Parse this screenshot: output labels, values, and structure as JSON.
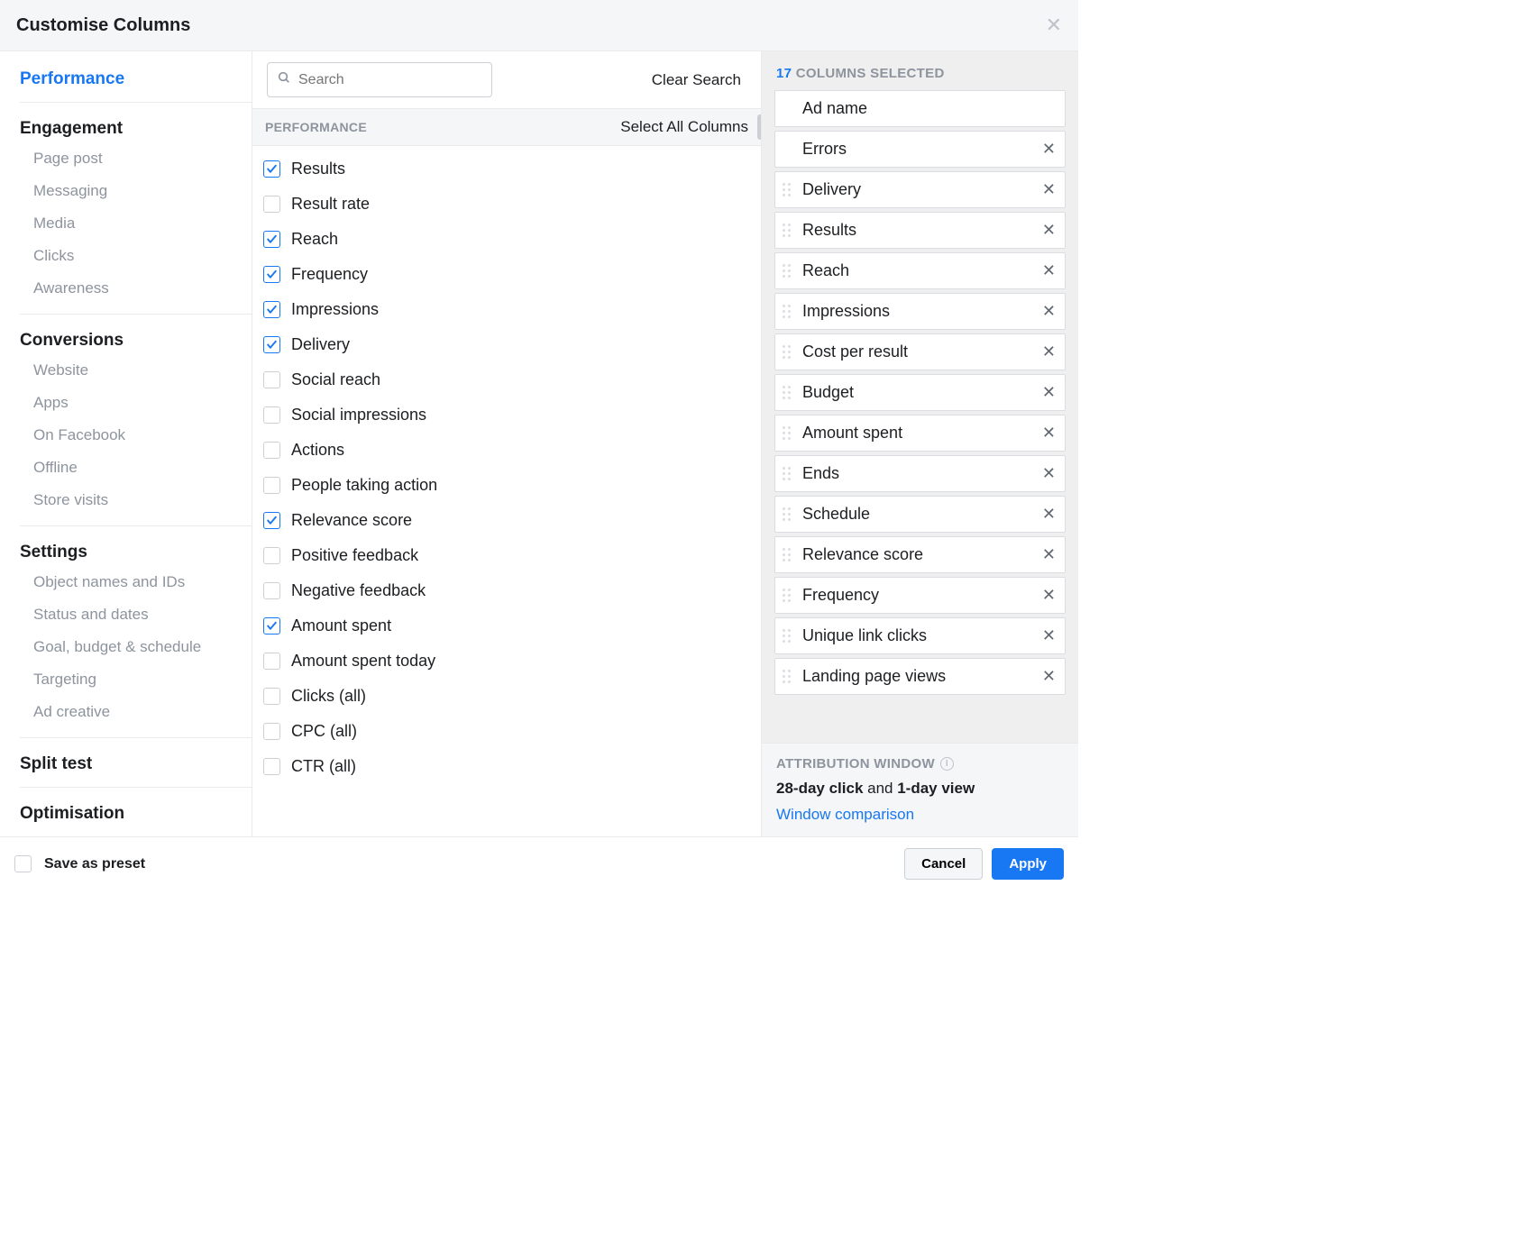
{
  "header": {
    "title": "Customise Columns"
  },
  "clear_search": "Clear Search",
  "search_placeholder": "Search",
  "section_header": "PERFORMANCE",
  "select_all": "Select All Columns",
  "sidebar": [
    {
      "heading": "Performance",
      "active": true,
      "items": []
    },
    {
      "heading": "Engagement",
      "items": [
        "Page post",
        "Messaging",
        "Media",
        "Clicks",
        "Awareness"
      ]
    },
    {
      "heading": "Conversions",
      "items": [
        "Website",
        "Apps",
        "On Facebook",
        "Offline",
        "Store visits"
      ]
    },
    {
      "heading": "Settings",
      "items": [
        "Object names and IDs",
        "Status and dates",
        "Goal, budget & schedule",
        "Targeting",
        "Ad creative"
      ]
    },
    {
      "heading": "Split test",
      "items": []
    },
    {
      "heading": "Optimisation",
      "items": []
    }
  ],
  "metrics": [
    {
      "label": "Results",
      "checked": true
    },
    {
      "label": "Result rate",
      "checked": false
    },
    {
      "label": "Reach",
      "checked": true
    },
    {
      "label": "Frequency",
      "checked": true
    },
    {
      "label": "Impressions",
      "checked": true
    },
    {
      "label": "Delivery",
      "checked": true
    },
    {
      "label": "Social reach",
      "checked": false
    },
    {
      "label": "Social impressions",
      "checked": false
    },
    {
      "label": "Actions",
      "checked": false
    },
    {
      "label": "People taking action",
      "checked": false
    },
    {
      "label": "Relevance score",
      "checked": true
    },
    {
      "label": "Positive feedback",
      "checked": false
    },
    {
      "label": "Negative feedback",
      "checked": false
    },
    {
      "label": "Amount spent",
      "checked": true
    },
    {
      "label": "Amount spent today",
      "checked": false
    },
    {
      "label": "Clicks (all)",
      "checked": false
    },
    {
      "label": "CPC (all)",
      "checked": false
    },
    {
      "label": "CTR (all)",
      "checked": false
    }
  ],
  "selected_count": "17",
  "selected_label": "COLUMNS SELECTED",
  "selected": [
    {
      "label": "Ad name",
      "draggable": false,
      "removable": false
    },
    {
      "label": "Errors",
      "draggable": false,
      "removable": true
    },
    {
      "label": "Delivery",
      "draggable": true,
      "removable": true
    },
    {
      "label": "Results",
      "draggable": true,
      "removable": true
    },
    {
      "label": "Reach",
      "draggable": true,
      "removable": true
    },
    {
      "label": "Impressions",
      "draggable": true,
      "removable": true
    },
    {
      "label": "Cost per result",
      "draggable": true,
      "removable": true
    },
    {
      "label": "Budget",
      "draggable": true,
      "removable": true
    },
    {
      "label": "Amount spent",
      "draggable": true,
      "removable": true
    },
    {
      "label": "Ends",
      "draggable": true,
      "removable": true
    },
    {
      "label": "Schedule",
      "draggable": true,
      "removable": true
    },
    {
      "label": "Relevance score",
      "draggable": true,
      "removable": true
    },
    {
      "label": "Frequency",
      "draggable": true,
      "removable": true
    },
    {
      "label": "Unique link clicks",
      "draggable": true,
      "removable": true
    },
    {
      "label": "Landing page views",
      "draggable": true,
      "removable": true
    }
  ],
  "attribution": {
    "title": "ATTRIBUTION WINDOW",
    "value_html_parts": [
      "28-day click",
      " and ",
      "1-day view"
    ],
    "link": "Window comparison"
  },
  "footer": {
    "save_preset": "Save as preset",
    "cancel": "Cancel",
    "apply": "Apply"
  }
}
